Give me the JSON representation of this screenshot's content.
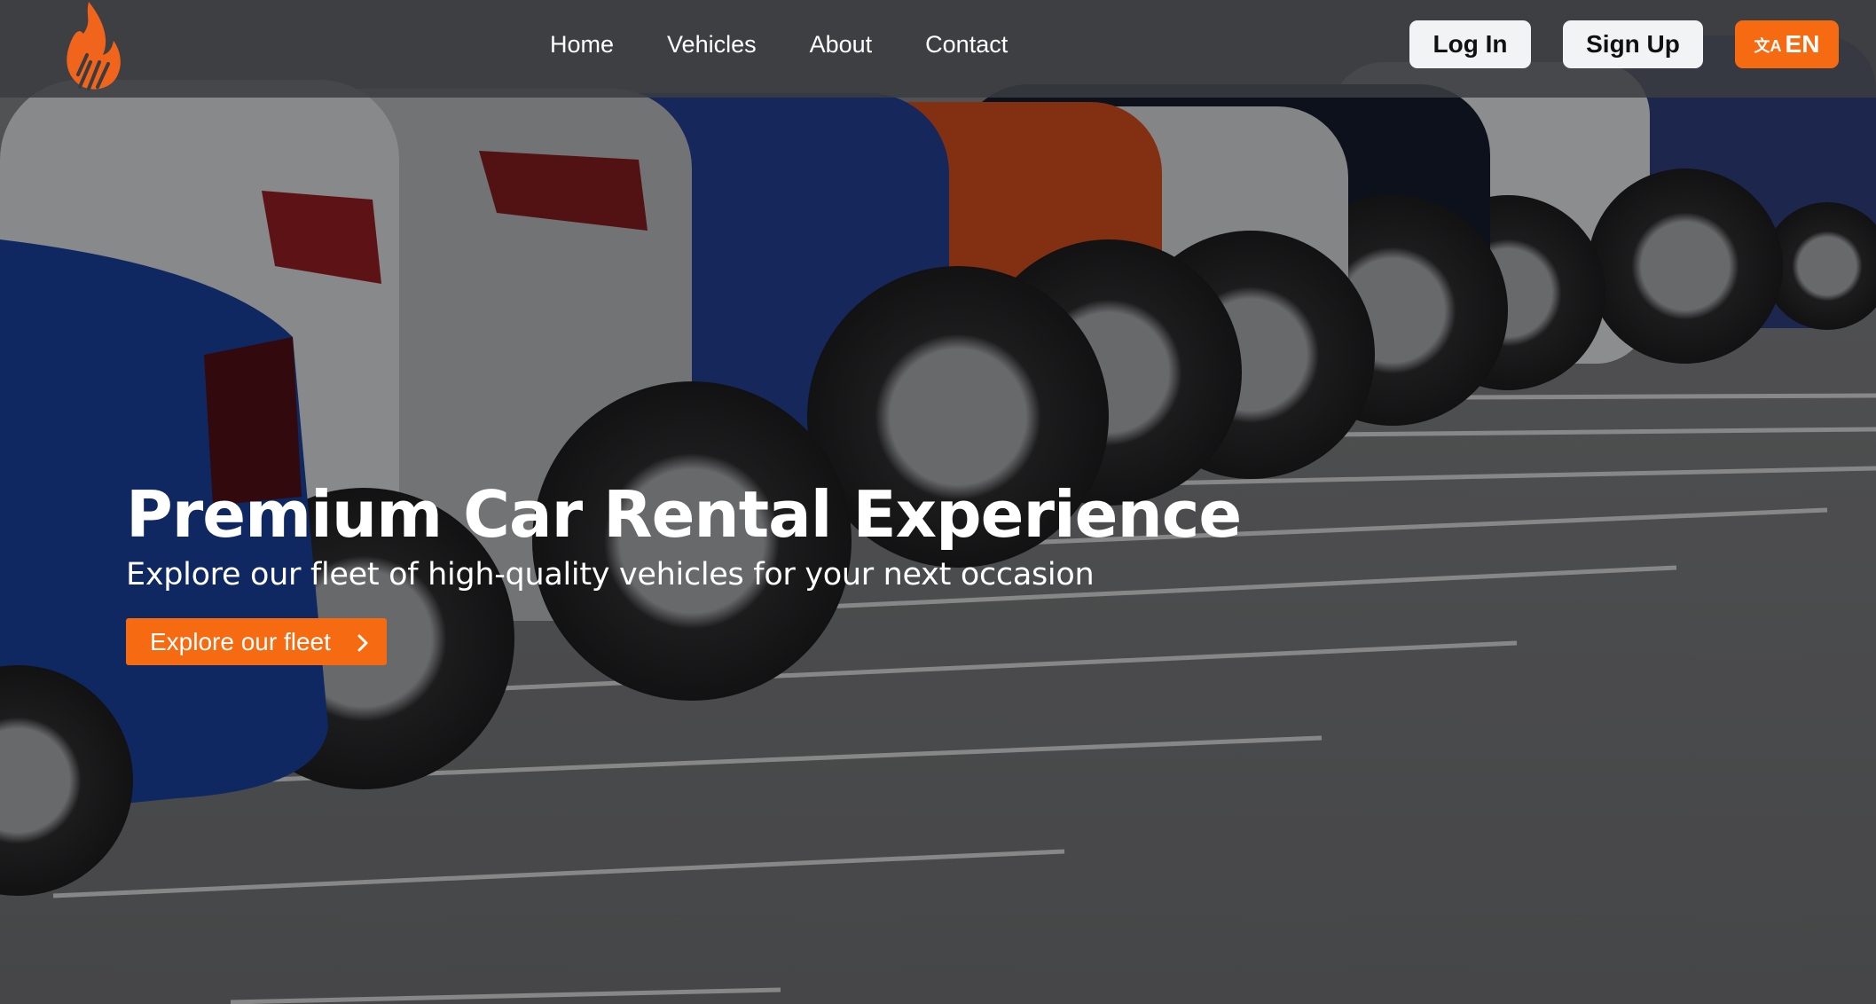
{
  "header": {
    "logo_icon": "flame-icon",
    "nav": [
      {
        "label": "Home"
      },
      {
        "label": "Vehicles"
      },
      {
        "label": "About"
      },
      {
        "label": "Contact"
      }
    ],
    "login_label": "Log In",
    "signup_label": "Sign Up",
    "language": {
      "icon": "translate-icon",
      "glyph": "文A",
      "label": "EN"
    }
  },
  "hero": {
    "title": "Premium Car Rental Experience",
    "subtitle": "Explore our fleet of high-quality vehicles for your next occasion",
    "cta_label": "Explore our fleet",
    "cta_icon": "chevron-right-icon",
    "background": "parked-cars-photo"
  },
  "colors": {
    "accent": "#f66a12",
    "header_bg": "#3a3c40",
    "button_light": "#f2f3f5"
  }
}
